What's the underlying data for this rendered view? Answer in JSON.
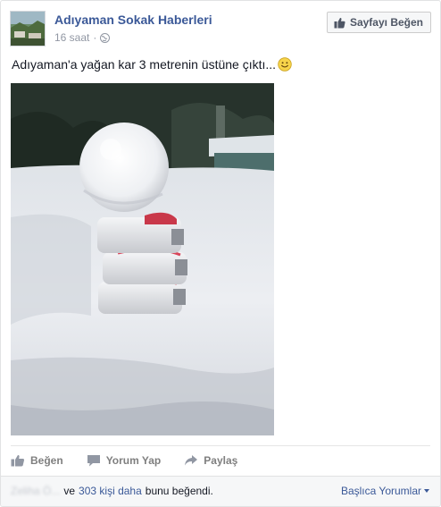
{
  "post": {
    "page_name": "Adıyaman Sokak Haberleri",
    "time": "16 saat",
    "separator": "·",
    "privacy_icon": "globe-icon",
    "like_page_label": "Sayfayı Beğen",
    "text": "Adıyaman'a yağan kar 3 metrenin üstüne çıktı...",
    "emoji": "smiley-emoji"
  },
  "actions": {
    "like_label": "Beğen",
    "comment_label": "Yorum Yap",
    "share_label": "Paylaş"
  },
  "footer": {
    "blurred_names": "Zeliha Ö...",
    "and_label": "ve",
    "likes_link": "303 kişi daha",
    "likes_suffix": "bunu beğendi.",
    "sort_label": "Başlıca Yorumlar"
  },
  "colors": {
    "brand_blue": "#3b5998",
    "muted_gray": "#9197a3",
    "action_gray": "#7f7f7f",
    "footer_bg": "#f6f7f8"
  }
}
